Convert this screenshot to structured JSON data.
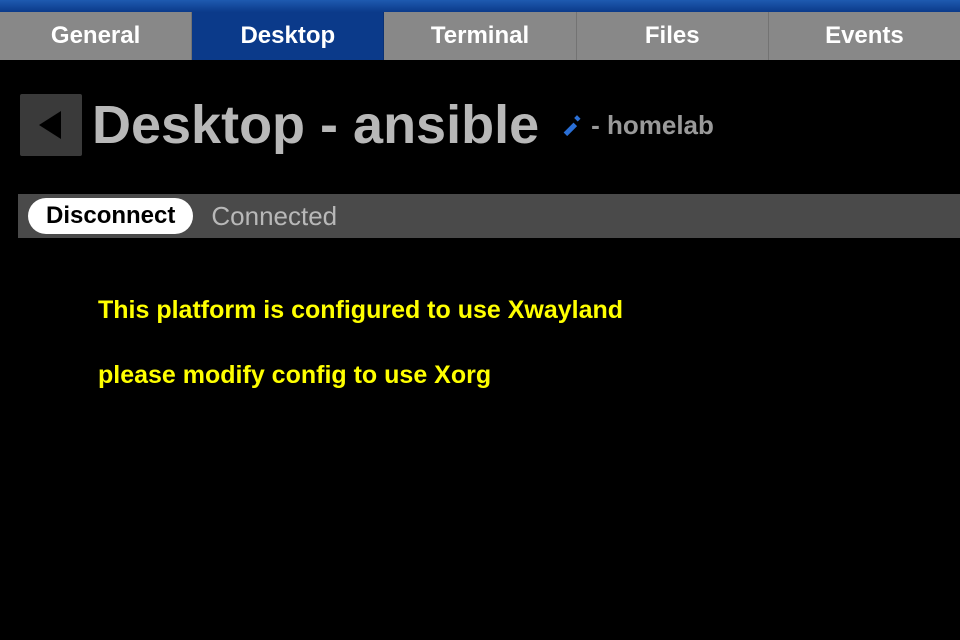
{
  "tabs": {
    "items": [
      {
        "label": "General"
      },
      {
        "label": "Desktop"
      },
      {
        "label": "Terminal"
      },
      {
        "label": "Files"
      },
      {
        "label": "Events"
      }
    ],
    "active_index": 1
  },
  "header": {
    "title": "Desktop - ansible",
    "subtitle": "- homelab"
  },
  "status": {
    "disconnect_label": "Disconnect",
    "status_text": "Connected"
  },
  "messages": {
    "line1": "This platform is configured to use Xwayland",
    "line2": "please modify config to use Xorg"
  },
  "colors": {
    "warning_text": "#ffff00",
    "tab_active_bg": "#0b3a8a",
    "tab_bg": "#888888"
  }
}
